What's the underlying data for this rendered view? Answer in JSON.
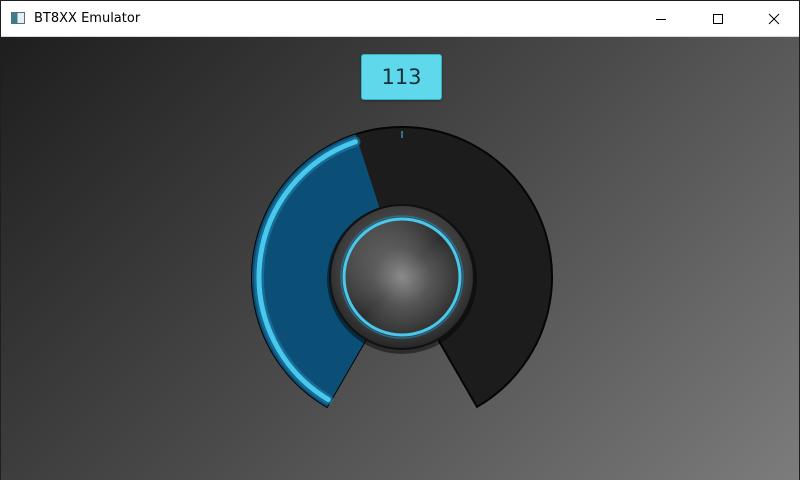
{
  "window": {
    "title": "BT8XX Emulator",
    "buttons": {
      "minimize": "minimize-icon",
      "maximize": "maximize-icon",
      "close": "close-icon"
    }
  },
  "dial": {
    "value": "113",
    "level": 0.44,
    "colors": {
      "accent": "#5fd8eb",
      "arc_glow": "#47c8ec",
      "fill": "#0b4f77",
      "track": "#1c1c1c",
      "value_box": "#5fd8eb"
    }
  }
}
